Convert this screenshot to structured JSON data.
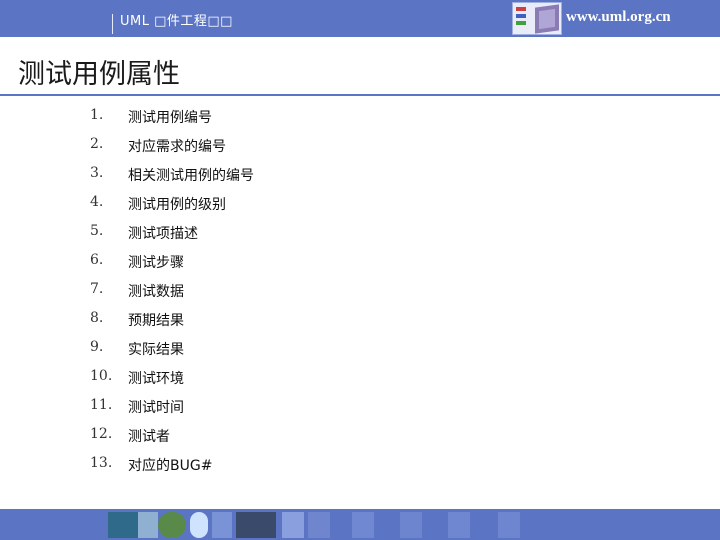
{
  "header": {
    "title": "UML □件工程□□",
    "url": "www.uml.org.cn",
    "colors": {
      "bar": "#5b74c4",
      "text": "#ffffff"
    }
  },
  "slide": {
    "title": "测试用例属性",
    "items": [
      {
        "num": "1.",
        "label": "测试用例编号"
      },
      {
        "num": "2.",
        "label": "对应需求的编号"
      },
      {
        "num": "3.",
        "label": "相关测试用例的编号"
      },
      {
        "num": "4.",
        "label": "测试用例的级别"
      },
      {
        "num": "5.",
        "label": "测试项描述"
      },
      {
        "num": "6.",
        "label": "测试步骤"
      },
      {
        "num": "7.",
        "label": "测试数据"
      },
      {
        "num": "8.",
        "label": "预期结果"
      },
      {
        "num": "9.",
        "label": "实际结果"
      },
      {
        "num": "10.",
        "label": "测试环境"
      },
      {
        "num": "11.",
        "label": "测试时间"
      },
      {
        "num": "12.",
        "label": "测试者"
      },
      {
        "num": "13.",
        "label": "对应的BUG#"
      }
    ]
  },
  "footer": {
    "decoration": "image-tile-strip"
  }
}
